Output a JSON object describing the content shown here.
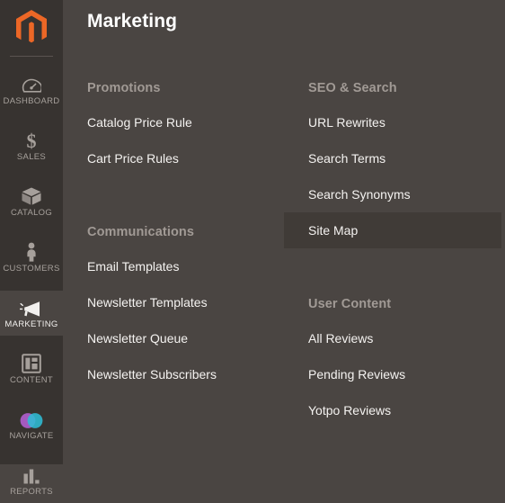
{
  "sidebar": {
    "logo": "magento-logo",
    "items": [
      {
        "label": "DASHBOARD",
        "icon": "dashboard-gauge-icon",
        "active": false
      },
      {
        "label": "SALES",
        "icon": "dollar-sign-icon",
        "active": false
      },
      {
        "label": "CATALOG",
        "icon": "box-icon",
        "active": false
      },
      {
        "label": "CUSTOMERS",
        "icon": "person-icon",
        "active": false
      },
      {
        "label": "MARKETING",
        "icon": "megaphone-icon",
        "active": true
      },
      {
        "label": "CONTENT",
        "icon": "layout-panel-icon",
        "active": false
      },
      {
        "label": "NAVIGATE",
        "icon": "venn-circles-icon",
        "active": false
      },
      {
        "label": "REPORTS",
        "icon": "bar-chart-icon",
        "active": false
      }
    ]
  },
  "page": {
    "title": "Marketing"
  },
  "menu": {
    "left_column": [
      {
        "heading": "Promotions",
        "links": [
          {
            "label": "Catalog Price Rule",
            "selected": false
          },
          {
            "label": "Cart Price Rules",
            "selected": false
          }
        ]
      },
      {
        "heading": "Communications",
        "links": [
          {
            "label": "Email Templates",
            "selected": false
          },
          {
            "label": "Newsletter Templates",
            "selected": false
          },
          {
            "label": "Newsletter Queue",
            "selected": false
          },
          {
            "label": "Newsletter Subscribers",
            "selected": false
          }
        ]
      }
    ],
    "right_column": [
      {
        "heading": "SEO & Search",
        "links": [
          {
            "label": "URL Rewrites",
            "selected": false
          },
          {
            "label": "Search Terms",
            "selected": false
          },
          {
            "label": "Search Synonyms",
            "selected": false
          },
          {
            "label": "Site Map",
            "selected": true
          }
        ]
      },
      {
        "heading": "User Content",
        "links": [
          {
            "label": "All Reviews",
            "selected": false
          },
          {
            "label": "Pending Reviews",
            "selected": false
          },
          {
            "label": "Yotpo Reviews",
            "selected": false
          }
        ]
      }
    ]
  },
  "colors": {
    "sidebar_bg": "#373330",
    "content_bg": "#4a4542",
    "selected_bg": "#403b37",
    "brand_orange": "#ec6726",
    "navigate_purple": "#a55ac0",
    "navigate_teal": "#2fbcd4",
    "heading_gray": "#a19a95",
    "link_white": "#f4f2f0"
  }
}
